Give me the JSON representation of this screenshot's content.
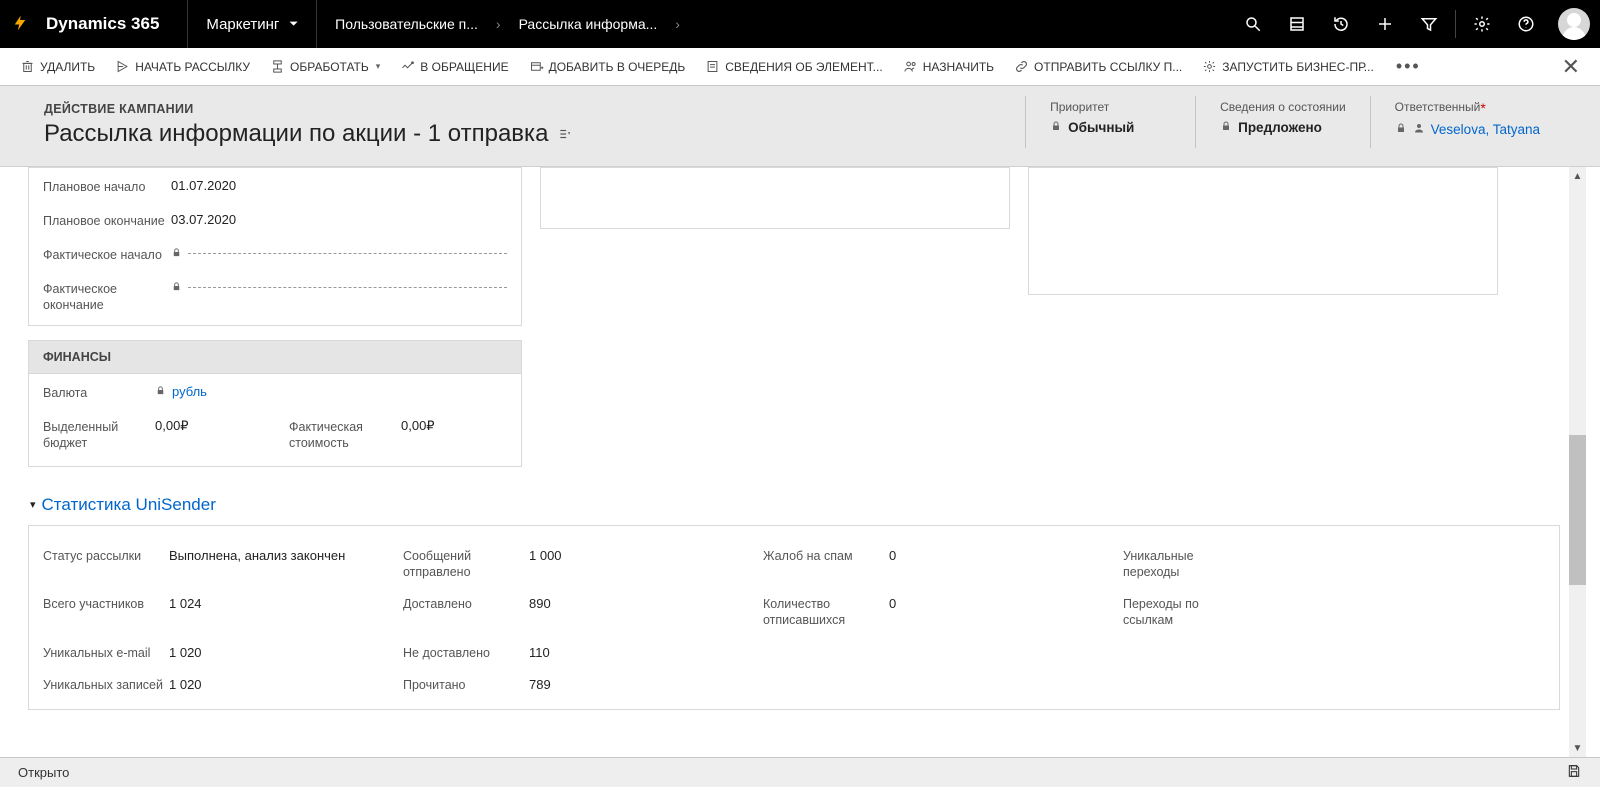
{
  "topbar": {
    "brand": "Dynamics 365",
    "module": "Маркетинг",
    "breadcrumb1": "Пользовательские п...",
    "breadcrumb2": "Рассылка информа..."
  },
  "cmdbar": {
    "delete": "УДАЛИТЬ",
    "start": "НАЧАТЬ РАССЫЛКУ",
    "process": "ОБРАБОТАТЬ",
    "case": "В ОБРАЩЕНИЕ",
    "queue": "ДОБАВИТЬ В ОЧЕРЕДЬ",
    "details": "СВЕДЕНИЯ ОБ ЭЛЕМЕНТ...",
    "assign": "НАЗНАЧИТЬ",
    "sendlink": "ОТПРАВИТЬ ССЫЛКУ П...",
    "runbp": "ЗАПУСТИТЬ БИЗНЕС-ПР..."
  },
  "header": {
    "entity_label": "ДЕЙСТВИЕ КАМПАНИИ",
    "title": "Рассылка информации по акции - 1 отправка",
    "priority_label": "Приоритет",
    "priority_value": "Обычный",
    "status_label": "Сведения о состоянии",
    "status_value": "Предложено",
    "owner_label": "Ответственный",
    "owner_value": "Veselova, Tatyana"
  },
  "dates": {
    "planned_start_label": "Плановое начало",
    "planned_start_value": "01.07.2020",
    "planned_end_label": "Плановое окончание",
    "planned_end_value": "03.07.2020",
    "actual_start_label": "Фактическое начало",
    "actual_end_label": "Фактическое окончание"
  },
  "finance": {
    "section": "ФИНАНСЫ",
    "currency_label": "Валюта",
    "currency_value": "рубль",
    "budget_label": "Выделенный бюджет",
    "budget_value": "0,00₽",
    "actual_cost_label": "Фактическая стоимость",
    "actual_cost_value": "0,00₽"
  },
  "stats": {
    "title": "Статистика UniSender",
    "status_label": "Статус рассылки",
    "status_value": "Выполнена, анализ закончен",
    "total_label": "Всего  участников",
    "total_value": "1 024",
    "unique_email_label": "Уникальных e-mail",
    "unique_email_value": "1 020",
    "unique_rec_label": "Уникальных записей",
    "unique_rec_value": "1 020",
    "sent_label": "Сообщений отправлено",
    "sent_value": "1 000",
    "delivered_label": "Доставлено",
    "delivered_value": "890",
    "not_delivered_label": "Не доставлено",
    "not_delivered_value": "110",
    "read_label": "Прочитано",
    "read_value": "789",
    "spam_label": "Жалоб на спам",
    "spam_value": "0",
    "unsub_label": "Количество отписавшихся",
    "unsub_value": "0",
    "unique_clicks_label": "Уникальные переходы",
    "link_clicks_label": "Переходы по ссылкам"
  },
  "footer": {
    "status": "Открыто"
  }
}
